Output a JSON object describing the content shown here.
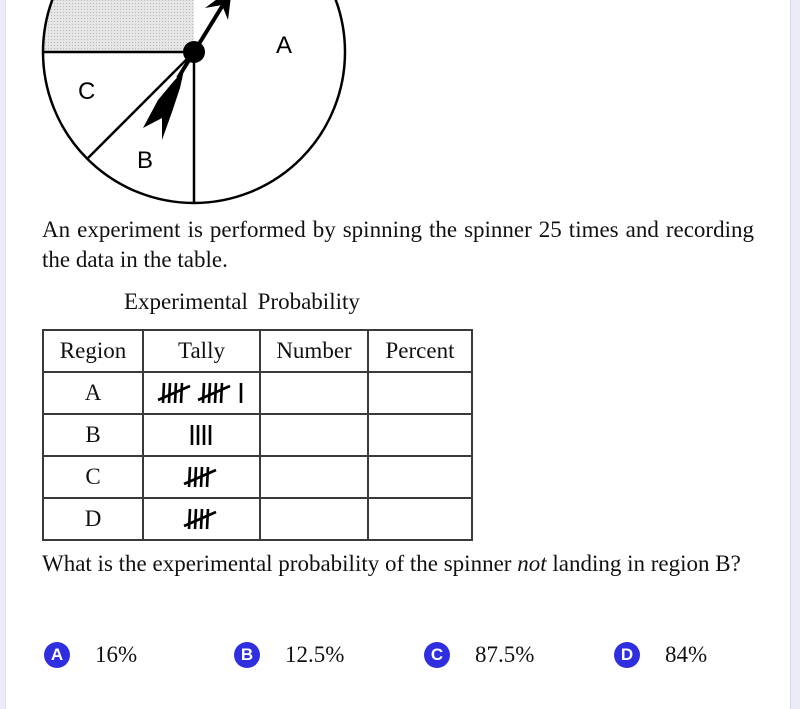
{
  "spinner": {
    "labels": {
      "A": "A",
      "B": "B",
      "C": "C"
    },
    "shaded_region": "D"
  },
  "intro_text": "An experiment is performed by spinning the spinner 25 times and recording the data in the table.",
  "table": {
    "title": "Experimental Probability",
    "headers": [
      "Region",
      "Tally",
      "Number",
      "Percent"
    ],
    "rows": [
      {
        "region": "A",
        "tally": 11,
        "number": "",
        "percent": ""
      },
      {
        "region": "B",
        "tally": 4,
        "number": "",
        "percent": ""
      },
      {
        "region": "C",
        "tally": 5,
        "number": "",
        "percent": ""
      },
      {
        "region": "D",
        "tally": 5,
        "number": "",
        "percent": ""
      }
    ]
  },
  "question": {
    "before": "What is the experimental probability of the spinner ",
    "emphasis": "not",
    "after": " landing in region B?"
  },
  "choices": [
    {
      "letter": "A",
      "text": "16%"
    },
    {
      "letter": "B",
      "text": "12.5%"
    },
    {
      "letter": "C",
      "text": "87.5%"
    },
    {
      "letter": "D",
      "text": "84%"
    }
  ],
  "colors": {
    "badge": "#2f2fe0",
    "shade": "#d8d8d8"
  }
}
